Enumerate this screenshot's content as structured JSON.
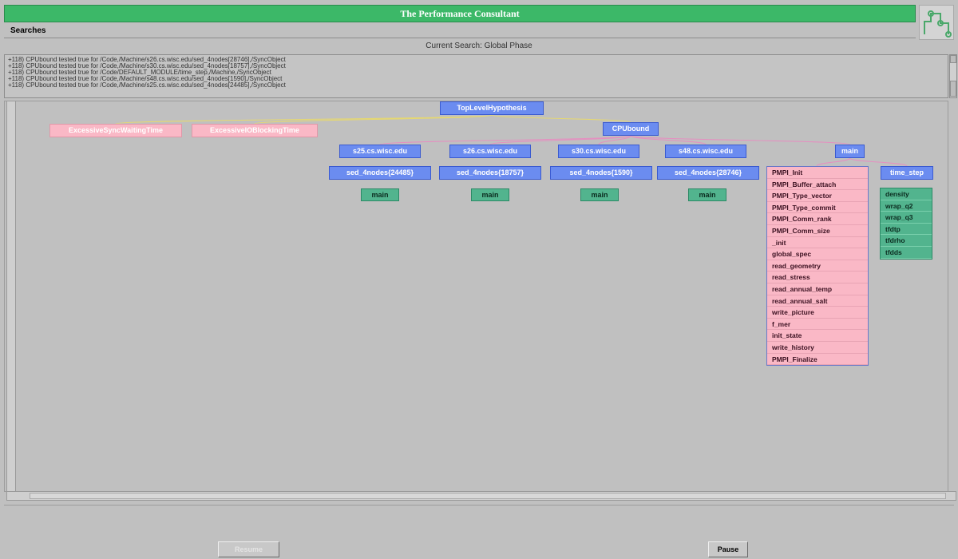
{
  "window": {
    "title": "The Performance Consultant"
  },
  "menu": {
    "searches_label": "Searches"
  },
  "search_status": "Current Search:  Global Phase",
  "log_lines": [
    "+118) CPUbound tested true for /Code,/Machine/s26.cs.wisc.edu/sed_4nodes[28746],/SyncObject",
    "+118) CPUbound tested true for /Code,/Machine/s30.cs.wisc.edu/sed_4nodes[18757],/SyncObject",
    "+118) CPUbound tested true for /Code/DEFAULT_MODULE/time_step,/Machine,/SyncObject",
    "+118) CPUbound tested true for /Code,/Machine/s48.cs.wisc.edu/sed_4nodes[1590],/SyncObject",
    "+118) CPUbound tested true for /Code,/Machine/s25.cs.wisc.edu/sed_4nodes[24485],/SyncObject"
  ],
  "tree": {
    "root": "TopLevelHypothesis",
    "pink_hypotheses": [
      "ExcessiveSyncWaitingTime",
      "ExcessiveIOBlockingTime"
    ],
    "cpubound": "CPUbound",
    "machines": [
      "s25.cs.wisc.edu",
      "s26.cs.wisc.edu",
      "s30.cs.wisc.edu",
      "s48.cs.wisc.edu"
    ],
    "processes": [
      "sed_4nodes{24485}",
      "sed_4nodes{18757}",
      "sed_4nodes{1590}",
      "sed_4nodes{28746}"
    ],
    "code_label": "main",
    "main_node": "main",
    "time_step_node": "time_step",
    "main_children": [
      "PMPI_Init",
      "PMPI_Buffer_attach",
      "PMPI_Type_vector",
      "PMPI_Type_commit",
      "PMPI_Comm_rank",
      "PMPI_Comm_size",
      "_init",
      "global_spec",
      "read_geometry",
      "read_stress",
      "read_annual_temp",
      "read_annual_salt",
      "write_picture",
      "f_mer",
      "init_state",
      "write_history",
      "PMPI_Finalize"
    ],
    "time_step_children": [
      "density",
      "wrap_q2",
      "wrap_q3",
      "tfdtp",
      "tfdrho",
      "tfdds"
    ]
  },
  "buttons": {
    "resume": "Resume",
    "pause": "Pause"
  },
  "colors": {
    "title_bar": "#3cb868",
    "blue_node": "#6b8cf0",
    "pink_node": "#fab8c6",
    "teal_node": "#52b48e",
    "edge_yellow": "#e6d870",
    "edge_pink": "#e58fc0"
  }
}
